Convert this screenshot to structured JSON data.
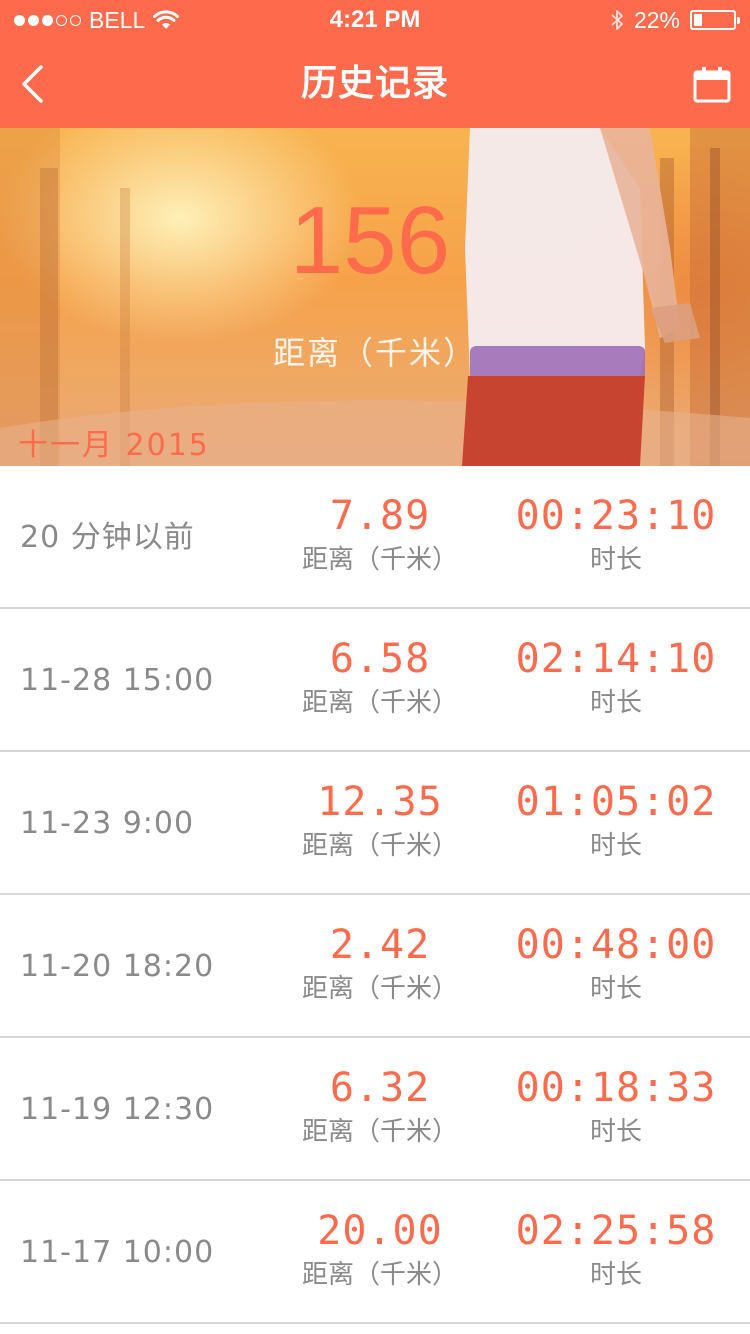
{
  "status": {
    "carrier": "BELL",
    "time": "4:21 PM",
    "battery_text": "22%",
    "battery_level": 0.22
  },
  "nav": {
    "title": "历史记录",
    "back_icon": "chevron-left-icon",
    "calendar_icon": "calendar-icon"
  },
  "hero": {
    "total": "156",
    "label": "距离（千米）",
    "month": "十一月 2015"
  },
  "records": [
    {
      "time": "20 分钟以前",
      "distance": "7.89",
      "distance_label": "距离（千米）",
      "duration": "00:23:10",
      "duration_label": "时长"
    },
    {
      "time": "11-28 15:00",
      "distance": "6.58",
      "distance_label": "距离（千米）",
      "duration": "02:14:10",
      "duration_label": "时长"
    },
    {
      "time": "11-23 9:00",
      "distance": "12.35",
      "distance_label": "距离（千米）",
      "duration": "01:05:02",
      "duration_label": "时长"
    },
    {
      "time": "11-20 18:20",
      "distance": "2.42",
      "distance_label": "距离（千米）",
      "duration": "00:48:00",
      "duration_label": "时长"
    },
    {
      "time": "11-19 12:30",
      "distance": "6.32",
      "distance_label": "距离（千米）",
      "duration": "00:18:33",
      "duration_label": "时长"
    },
    {
      "time": "11-17 10:00",
      "distance": "20.00",
      "distance_label": "距离（千米）",
      "duration": "02:25:58",
      "duration_label": "时长"
    }
  ],
  "colors": {
    "accent": "#fd6a4c",
    "muted_text": "#8a8a8a",
    "divider": "#d6d6d6"
  }
}
